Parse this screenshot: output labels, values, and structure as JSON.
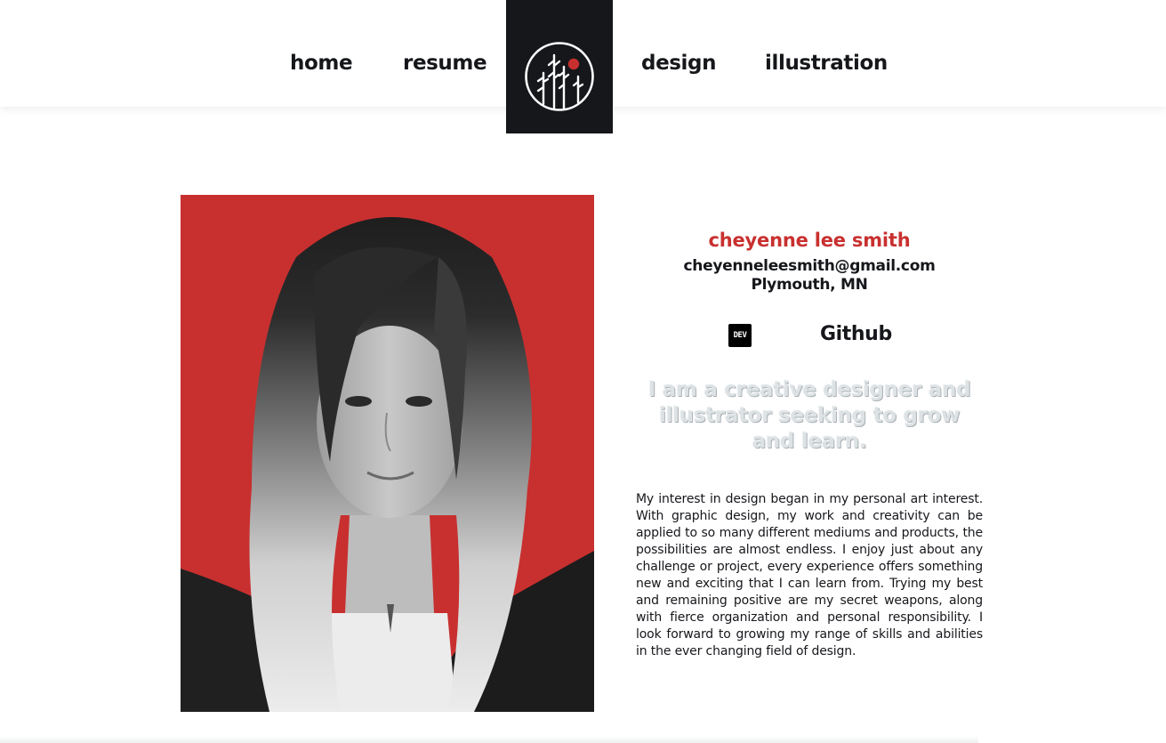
{
  "nav": {
    "items": [
      {
        "label": "home"
      },
      {
        "label": "resume"
      },
      {
        "label": "design"
      },
      {
        "label": "illustration"
      }
    ],
    "logo_icon": "pine-trees-sun-logo-icon"
  },
  "profile": {
    "name": "cheyenne lee smith",
    "email": "cheyenneleesmith@gmail.com",
    "location": "Plymouth, MN",
    "dev_badge": "DEV",
    "github_label": "Github",
    "tagline": "I am a creative designer and illustrator seeking to grow and learn.",
    "bio": "My interest in design began in my personal art interest. With graphic design, my work and creativity can be applied to so many different mediums and products, the possibilities are almost endless. I enjoy just about any challenge or project, every experience offers something new and exciting that I can learn from. Trying my best and remaining positive are my secret weapons, along with fierce organization and personal responsibility. I look forward to growing my range of skills and abilities in the ever changing field of design."
  },
  "colors": {
    "accent": "#c8302f",
    "dark": "#16171b",
    "tagline": "#dde2e4"
  }
}
